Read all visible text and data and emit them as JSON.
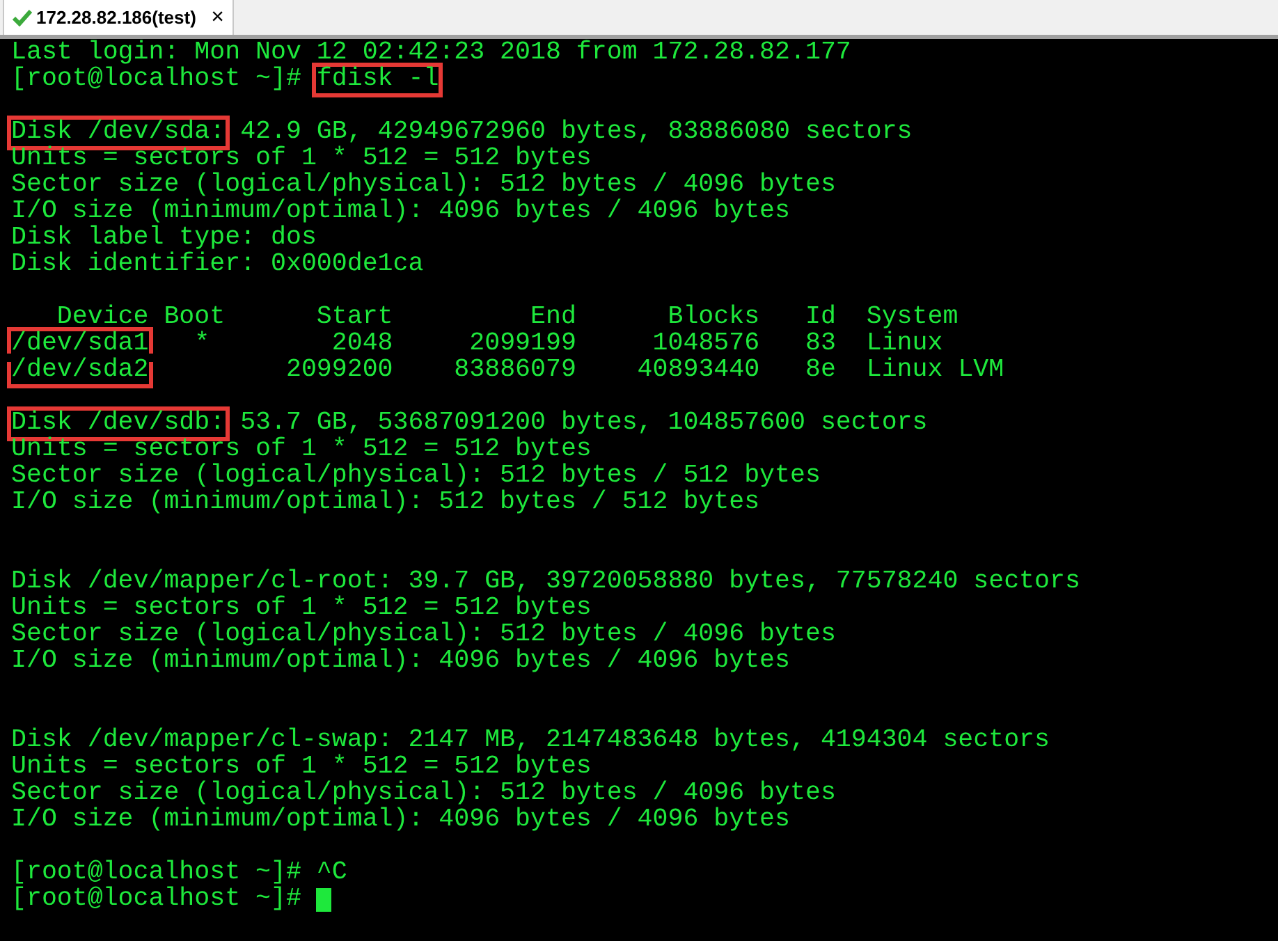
{
  "tab": {
    "title": "172.28.82.186(test)",
    "connected": true,
    "close": "×"
  },
  "terminal": {
    "lines": [
      {
        "kind": "text",
        "segments": [
          {
            "text": "Last login: Mon Nov 12 02:42:23 2018 from 172.28.82.177"
          }
        ]
      },
      {
        "kind": "text",
        "segments": [
          {
            "text": "[root@localhost ~]# "
          },
          {
            "text": "fdisk -l",
            "boxed": true
          }
        ]
      },
      {
        "kind": "blank"
      },
      {
        "kind": "text",
        "segments": [
          {
            "text": "Disk /dev/sda:",
            "boxed": true
          },
          {
            "text": " 42.9 GB, 42949672960 bytes, 83886080 sectors"
          }
        ]
      },
      {
        "kind": "text",
        "segments": [
          {
            "text": "Units = sectors of 1 * 512 = 512 bytes"
          }
        ]
      },
      {
        "kind": "text",
        "segments": [
          {
            "text": "Sector size (logical/physical): 512 bytes / 4096 bytes"
          }
        ]
      },
      {
        "kind": "text",
        "segments": [
          {
            "text": "I/O size (minimum/optimal): 4096 bytes / 4096 bytes"
          }
        ]
      },
      {
        "kind": "text",
        "segments": [
          {
            "text": "Disk label type: dos"
          }
        ]
      },
      {
        "kind": "text",
        "segments": [
          {
            "text": "Disk identifier: 0x000de1ca"
          }
        ]
      },
      {
        "kind": "blank"
      },
      {
        "kind": "text",
        "segments": [
          {
            "text": "   Device Boot      Start         End      Blocks   Id  System"
          }
        ]
      },
      {
        "kind": "text",
        "segments": [
          {
            "text": "/dev/sda1",
            "boxed": true,
            "box_continues_below": true
          },
          {
            "text": "   *        2048     2099199     1048576   83  Linux"
          }
        ]
      },
      {
        "kind": "text",
        "segments": [
          {
            "text": "/dev/sda2",
            "boxed": true,
            "box_continues_above": true
          },
          {
            "text": "         2099200    83886079    40893440   8e  Linux LVM"
          }
        ]
      },
      {
        "kind": "blank"
      },
      {
        "kind": "text",
        "segments": [
          {
            "text": "Disk /dev/sdb:",
            "boxed": true
          },
          {
            "text": " 53.7 GB, 53687091200 bytes, 104857600 sectors"
          }
        ]
      },
      {
        "kind": "text",
        "segments": [
          {
            "text": "Units = sectors of 1 * 512 = 512 bytes"
          }
        ]
      },
      {
        "kind": "text",
        "segments": [
          {
            "text": "Sector size (logical/physical): 512 bytes / 512 bytes"
          }
        ]
      },
      {
        "kind": "text",
        "segments": [
          {
            "text": "I/O size (minimum/optimal): 512 bytes / 512 bytes"
          }
        ]
      },
      {
        "kind": "blank"
      },
      {
        "kind": "blank"
      },
      {
        "kind": "text",
        "segments": [
          {
            "text": "Disk /dev/mapper/cl-root: 39.7 GB, 39720058880 bytes, 77578240 sectors"
          }
        ]
      },
      {
        "kind": "text",
        "segments": [
          {
            "text": "Units = sectors of 1 * 512 = 512 bytes"
          }
        ]
      },
      {
        "kind": "text",
        "segments": [
          {
            "text": "Sector size (logical/physical): 512 bytes / 4096 bytes"
          }
        ]
      },
      {
        "kind": "text",
        "segments": [
          {
            "text": "I/O size (minimum/optimal): 4096 bytes / 4096 bytes"
          }
        ]
      },
      {
        "kind": "blank"
      },
      {
        "kind": "blank"
      },
      {
        "kind": "text",
        "segments": [
          {
            "text": "Disk /dev/mapper/cl-swap: 2147 MB, 2147483648 bytes, 4194304 sectors"
          }
        ]
      },
      {
        "kind": "text",
        "segments": [
          {
            "text": "Units = sectors of 1 * 512 = 512 bytes"
          }
        ]
      },
      {
        "kind": "text",
        "segments": [
          {
            "text": "Sector size (logical/physical): 512 bytes / 4096 bytes"
          }
        ]
      },
      {
        "kind": "text",
        "segments": [
          {
            "text": "I/O size (minimum/optimal): 4096 bytes / 4096 bytes"
          }
        ]
      },
      {
        "kind": "blank"
      },
      {
        "kind": "text",
        "segments": [
          {
            "text": "[root@localhost ~]# ^C"
          }
        ]
      },
      {
        "kind": "text",
        "segments": [
          {
            "text": "[root@localhost ~]# "
          }
        ],
        "cursor": true
      }
    ]
  }
}
